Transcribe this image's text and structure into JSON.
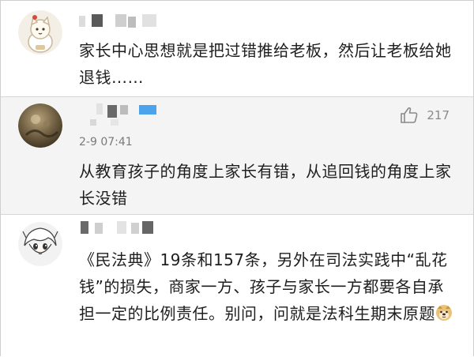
{
  "comments": [
    {
      "text": "家长中心思想就是把过错推给老板，然后让老板给她退钱……"
    },
    {
      "time": "2-9 07:41",
      "likes": "217",
      "text": "从教育孩子的角度上家长有错，从追回钱的角度上家长没错"
    },
    {
      "text": "《民法典》19条和157条，另外在司法实践中“乱花钱”的损失，商家一方、孩子与家长一方都要各自承担一定的比例责任。别问，问就是法科生期末原题"
    }
  ],
  "icons": {
    "like": "thumbs-up-icon",
    "emoji": "doge-emoji-icon"
  },
  "colors": {
    "highlight_background": "#f4f4f4",
    "name_accent": "#4aa3ec"
  }
}
